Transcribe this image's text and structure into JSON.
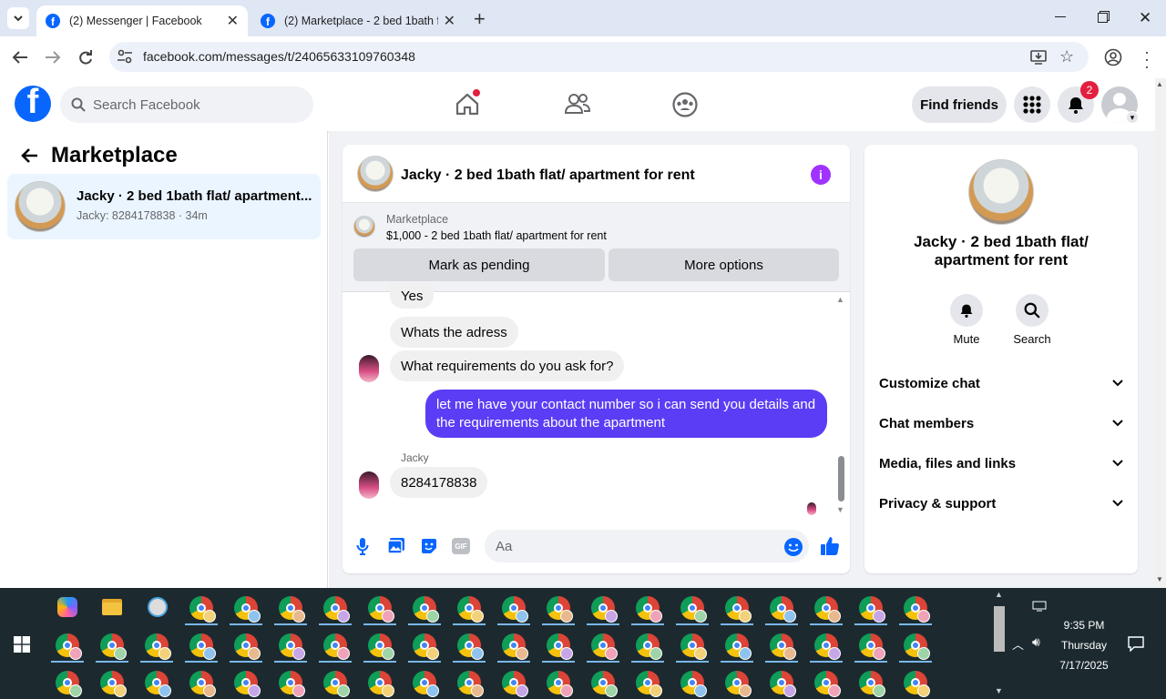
{
  "browser": {
    "tabs": [
      {
        "title": "(2) Messenger | Facebook",
        "active": true
      },
      {
        "title": "(2) Marketplace - 2 bed 1bath f",
        "active": false
      }
    ],
    "url": "facebook.com/messages/t/24065633109760348"
  },
  "fb_header": {
    "search_placeholder": "Search Facebook",
    "find_friends": "Find friends",
    "notification_count": "2",
    "brand_color": "#0866ff"
  },
  "left_panel": {
    "title": "Marketplace",
    "thread": {
      "name": "Jacky · 2 bed 1bath flat/ apartment...",
      "preview": "Jacky: 8284178838 · 34m"
    }
  },
  "chat": {
    "title": "Jacky · 2 bed 1bath flat/ apartment for rent",
    "marketplace_label": "Marketplace",
    "listing": "$1,000 - 2 bed 1bath flat/ apartment for rent",
    "mark_pending": "Mark as pending",
    "more_options": "More options",
    "messages": [
      {
        "from": "them",
        "text": "Yes"
      },
      {
        "from": "them",
        "text": "Whats the adress"
      },
      {
        "from": "them",
        "text": "What requirements do you ask for?"
      },
      {
        "from": "me",
        "text": "let me have your contact number so i can send you details and the requirements about the apartment"
      },
      {
        "from": "them",
        "sender": "Jacky",
        "text": "8284178838"
      }
    ],
    "input_placeholder": "Aa",
    "gif_label": "GIF",
    "accent_color": "#5b3df5"
  },
  "info_panel": {
    "title": "Jacky · 2 bed 1bath flat/ apartment for rent",
    "mute": "Mute",
    "search": "Search",
    "sections": [
      "Customize chat",
      "Chat members",
      "Media, files and links",
      "Privacy & support"
    ]
  },
  "taskbar": {
    "time": "9:35 PM",
    "day": "Thursday",
    "date": "7/17/2025"
  }
}
